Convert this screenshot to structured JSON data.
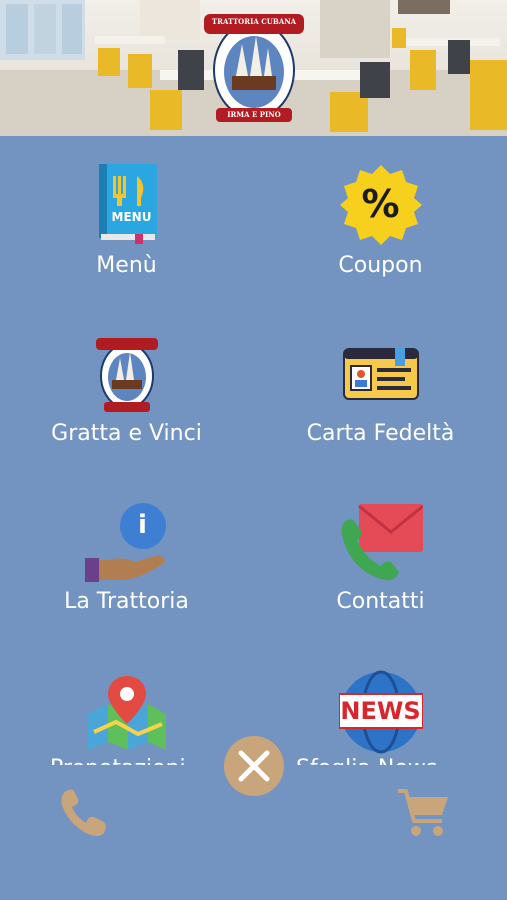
{
  "header": {
    "logo_top_text": "TRATTORIA CUBANA",
    "logo_bottom_text": "IRMA E PINO"
  },
  "tiles": [
    {
      "label": "Menù",
      "icon": "menu-book-icon",
      "icon_text": "MENU"
    },
    {
      "label": "Coupon",
      "icon": "coupon-percent-icon",
      "icon_text": "%"
    },
    {
      "label": "Gratta e Vinci",
      "icon": "scratch-logo-icon"
    },
    {
      "label": "Carta Fedeltà",
      "icon": "loyalty-card-icon"
    },
    {
      "label": "La Trattoria",
      "icon": "info-hand-icon",
      "icon_text": "i"
    },
    {
      "label": "Contatti",
      "icon": "phone-mail-icon"
    },
    {
      "label": "Prenotazioni",
      "icon": "map-pin-icon"
    },
    {
      "label": "Sfoglia News",
      "icon": "news-globe-icon",
      "icon_text": "NEWS"
    }
  ],
  "bottom_bar": {
    "left_icon": "phone-icon",
    "center_icon": "close-icon",
    "right_icon": "cart-icon"
  },
  "colors": {
    "background": "#7394c0",
    "accent": "#c9a57c",
    "text": "#ffffff"
  }
}
